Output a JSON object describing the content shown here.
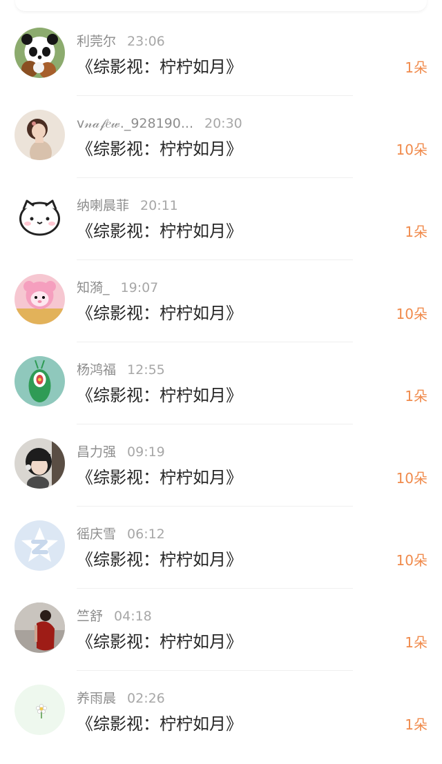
{
  "entries": [
    {
      "name": "利莞尔",
      "time": "23:06",
      "message": "《综影视：柠柠如月》",
      "gift": "1朵",
      "avatar_icon": "panda-cartoon-avatar-icon"
    },
    {
      "name": "v𝓃𝒶𝒻𝑒𝓌._928190...",
      "time": "20:30",
      "message": "《综影视：柠柠如月》",
      "gift": "10朵",
      "avatar_icon": "girl-photo-avatar-icon"
    },
    {
      "name": "纳喇晨菲",
      "time": "20:11",
      "message": "《综影视：柠柠如月》",
      "gift": "1朵",
      "avatar_icon": "cute-face-avatar-icon"
    },
    {
      "name": "知漪_",
      "time": "19:07",
      "message": "《综影视：柠柠如月》",
      "gift": "10朵",
      "avatar_icon": "pink-sheep-avatar-icon"
    },
    {
      "name": "杨鸿福",
      "time": "12:55",
      "message": "《综影视：柠柠如月》",
      "gift": "1朵",
      "avatar_icon": "plankton-avatar-icon"
    },
    {
      "name": "昌力强",
      "time": "09:19",
      "message": "《综影视：柠柠如月》",
      "gift": "10朵",
      "avatar_icon": "child-photo-avatar-icon"
    },
    {
      "name": "徭庆雪",
      "time": "06:12",
      "message": "《综影视：柠柠如月》",
      "gift": "10朵",
      "avatar_icon": "default-star-avatar-icon"
    },
    {
      "name": "竺舒",
      "time": "04:18",
      "message": "《综影视：柠柠如月》",
      "gift": "1朵",
      "avatar_icon": "red-dress-photo-avatar-icon"
    },
    {
      "name": "养雨晨",
      "time": "02:26",
      "message": "《综影视：柠柠如月》",
      "gift": "1朵",
      "avatar_icon": "flower-avatar-icon"
    }
  ],
  "colors": {
    "gift": "#f08a4b",
    "name": "#8d8d8d",
    "time": "#a7a7a7",
    "message": "#262626",
    "divider": "#efefef"
  }
}
